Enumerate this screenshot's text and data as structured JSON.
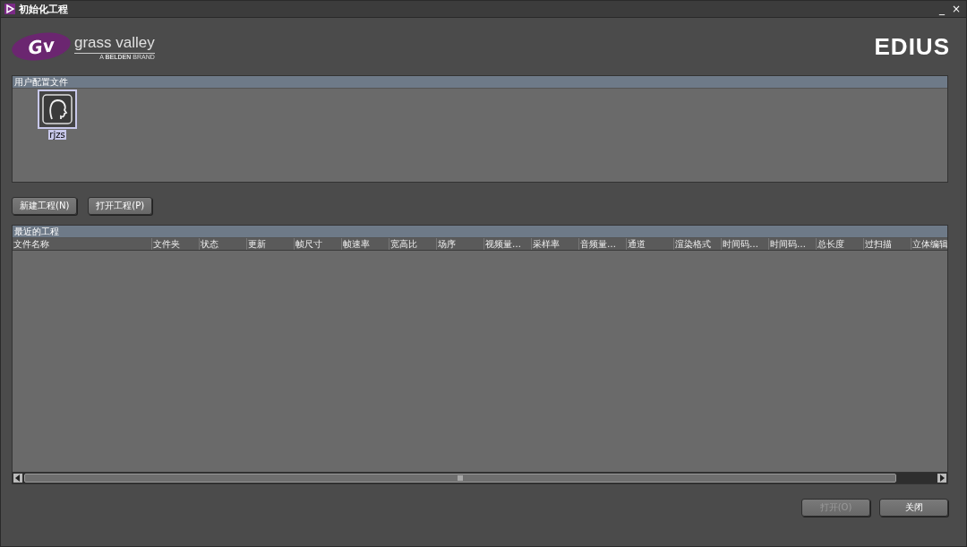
{
  "window": {
    "title": "初始化工程",
    "controls": [
      "_",
      "×"
    ]
  },
  "branding": {
    "logo_mark": "Gv",
    "company": "grass valley",
    "tagline_prefix": "A ",
    "tagline_bold": "BELDEN",
    "tagline_suffix": " BRAND",
    "product": "EDIUS"
  },
  "profiles": {
    "title": "用户配置文件",
    "items": [
      {
        "name": "rjzs",
        "selected": true
      }
    ]
  },
  "project_buttons": [
    {
      "label": "新建工程(N)"
    },
    {
      "label": "打开工程(P)"
    }
  ],
  "recent": {
    "title": "最近的工程",
    "columns": [
      "文件名称",
      "文件夹",
      "状态",
      "更新",
      "帧尺寸",
      "帧速率",
      "宽高比",
      "场序",
      "视频量…",
      "采样率",
      "音频量…",
      "通道",
      "渲染格式",
      "时间码…",
      "时间码…",
      "总长度",
      "过扫描",
      "立体编辑"
    ]
  },
  "footer_buttons": [
    {
      "label": "打开(O)",
      "disabled": true
    },
    {
      "label": "关闭",
      "disabled": false
    }
  ]
}
